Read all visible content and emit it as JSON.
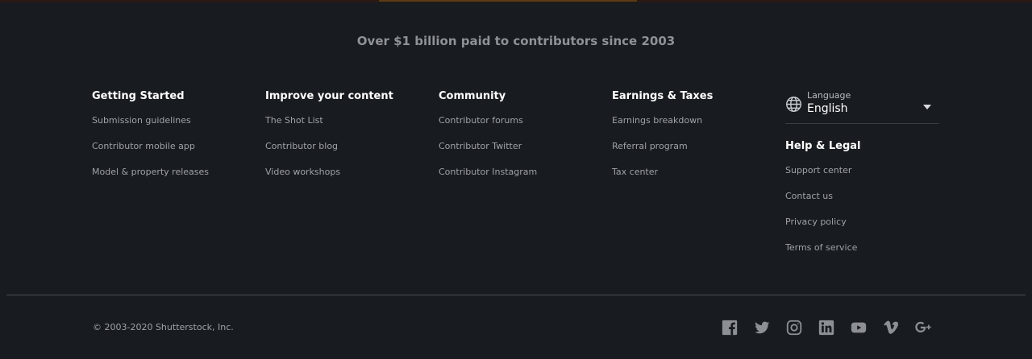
{
  "tagline": "Over $1 billion paid to contributors since 2003",
  "columns": [
    {
      "heading": "Getting Started",
      "links": [
        "Submission guidelines",
        "Contributor mobile app",
        "Model & property releases"
      ]
    },
    {
      "heading": "Improve your content",
      "links": [
        "The Shot List",
        "Contributor blog",
        "Video workshops"
      ]
    },
    {
      "heading": "Community",
      "links": [
        "Contributor forums",
        "Contributor Twitter",
        "Contributor Instagram"
      ]
    },
    {
      "heading": "Earnings & Taxes",
      "links": [
        "Earnings breakdown",
        "Referral program",
        "Tax center"
      ]
    }
  ],
  "language": {
    "label": "Language",
    "value": "English",
    "icon": "globe-icon"
  },
  "help": {
    "heading": "Help & Legal",
    "links": [
      "Support center",
      "Contact us",
      "Privacy policy",
      "Terms of service"
    ]
  },
  "copyright": "© 2003-2020 Shutterstock, Inc.",
  "social": [
    "facebook-icon",
    "twitter-icon",
    "instagram-icon",
    "linkedin-icon",
    "youtube-icon",
    "vimeo-icon",
    "google-plus-icon"
  ],
  "colors": {
    "background": "#181b20",
    "heading": "#ffffff",
    "link": "#9fa2a6",
    "icon": "#8c8f93"
  }
}
